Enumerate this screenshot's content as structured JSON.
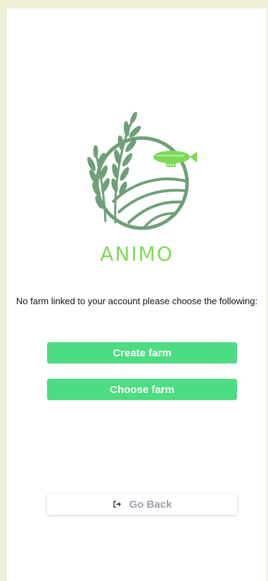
{
  "brand": {
    "name": "ANIMO",
    "name_color": "#7ed957",
    "logo_icons": [
      "wheat-icon",
      "field-icon",
      "blimp-icon"
    ]
  },
  "message": {
    "text": "No farm linked to your account please choose the following:"
  },
  "actions": {
    "create_farm_label": "Create farm",
    "choose_farm_label": "Choose farm",
    "go_back_label": "Go Back"
  },
  "colors": {
    "primary": "#4cdc82",
    "logo_green": "#6f9f78",
    "blimp_green": "#7ed957",
    "background": "#f0efd8"
  }
}
